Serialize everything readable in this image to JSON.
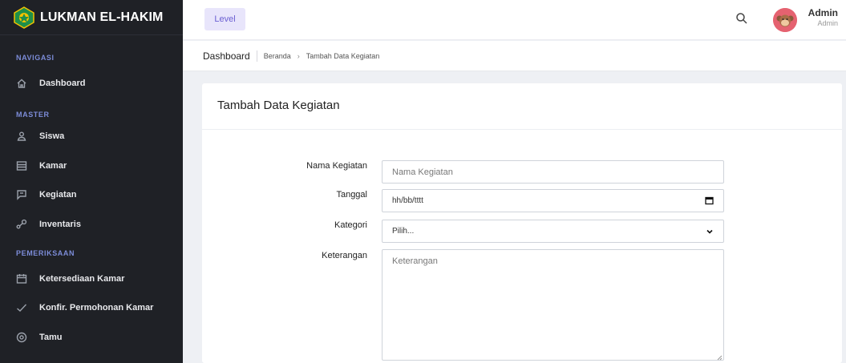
{
  "brand": {
    "name": "LUKMAN EL-HAKIM"
  },
  "sidebar": {
    "sections": [
      {
        "label": "NAVIGASI"
      },
      {
        "label": "MASTER"
      },
      {
        "label": "PEMERIKSAAN"
      }
    ],
    "items": [
      {
        "label": "Dashboard",
        "icon": "home-icon"
      },
      {
        "label": "Siswa",
        "icon": "user-icon"
      },
      {
        "label": "Kamar",
        "icon": "list-icon"
      },
      {
        "label": "Kegiatan",
        "icon": "flag-icon"
      },
      {
        "label": "Inventaris",
        "icon": "network-icon"
      },
      {
        "label": "Ketersediaan Kamar",
        "icon": "calendar-icon"
      },
      {
        "label": "Konfir. Permohonan Kamar",
        "icon": "check-icon"
      },
      {
        "label": "Tamu",
        "icon": "target-icon"
      }
    ]
  },
  "topbar": {
    "level_label": "Level",
    "user_name": "Admin",
    "user_role": "Admin"
  },
  "breadcrumb": {
    "title": "Dashboard",
    "items": [
      "Beranda",
      "Tambah Data Kegiatan"
    ]
  },
  "form": {
    "title": "Tambah Data Kegiatan",
    "nama_label": "Nama Kegiatan",
    "nama_placeholder": "Nama Kegiatan",
    "tanggal_label": "Tanggal",
    "tanggal_value": "hh/bb/tttt",
    "kategori_label": "Kategori",
    "kategori_value": "Pilih...",
    "keterangan_label": "Keterangan",
    "keterangan_placeholder": "Keterangan"
  },
  "colors": {
    "sidebar_bg": "#1f2126",
    "section_label": "#7c8cd8",
    "level_bg": "#e8e5fb",
    "level_text": "#6b5fd3",
    "avatar_bg": "#e56270"
  }
}
